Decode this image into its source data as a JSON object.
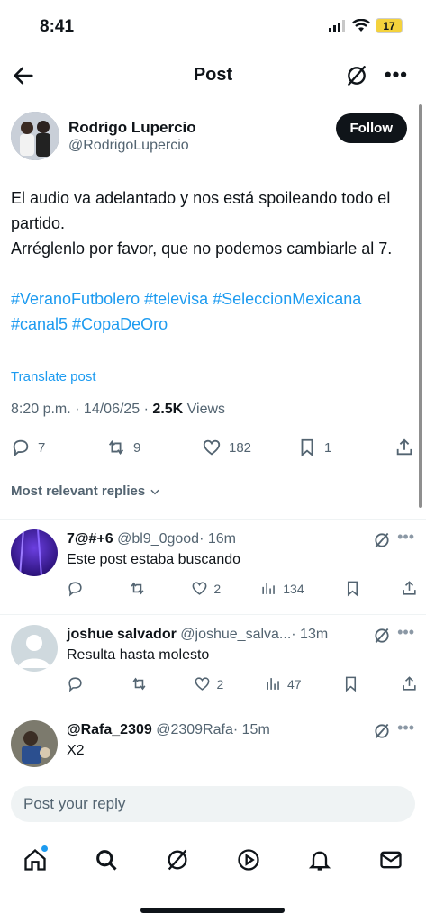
{
  "status": {
    "time": "8:41",
    "battery": "17"
  },
  "header": {
    "title": "Post"
  },
  "post": {
    "author_name": "Rodrigo Lupercio",
    "author_handle": "@RodrigoLupercio",
    "follow_label": "Follow",
    "text": "El audio va adelantado y nos está spoileando todo el partido.\nArréglenlo por favor, que no podemos cambiarle al 7.",
    "hashtags": "#VeranoFutbolero #televisa #SeleccionMexicana #canal5 #CopaDeOro",
    "translate_label": "Translate post",
    "date": "8:20 p.m. · 14/06/25 · ",
    "views_count": "2.5K",
    "views_label": " Views",
    "replies": "7",
    "reposts": "9",
    "likes": "182",
    "bookmarks": "1"
  },
  "replies_filter": "Most relevant replies",
  "replies": [
    {
      "name": "7@#+6",
      "handle": "@bl9_0good",
      "time": "· 16m",
      "text": "Este post estaba buscando",
      "replies": "",
      "reposts": "",
      "likes": "2",
      "views": "134"
    },
    {
      "name": "joshue salvador",
      "handle": "@joshue_salva...",
      "time": "· 13m",
      "text": "Resulta hasta molesto",
      "replies": "",
      "reposts": "",
      "likes": "2",
      "views": "47"
    },
    {
      "name": "@Rafa_2309",
      "handle": "@2309Rafa",
      "time": "· 15m",
      "text": "X2",
      "replies": "",
      "reposts": "",
      "likes": "",
      "views": ""
    }
  ],
  "composer": {
    "placeholder": "Post your reply"
  },
  "colors": {
    "accent": "#1d9bf0",
    "text": "#0f1419",
    "secondary": "#536471"
  }
}
